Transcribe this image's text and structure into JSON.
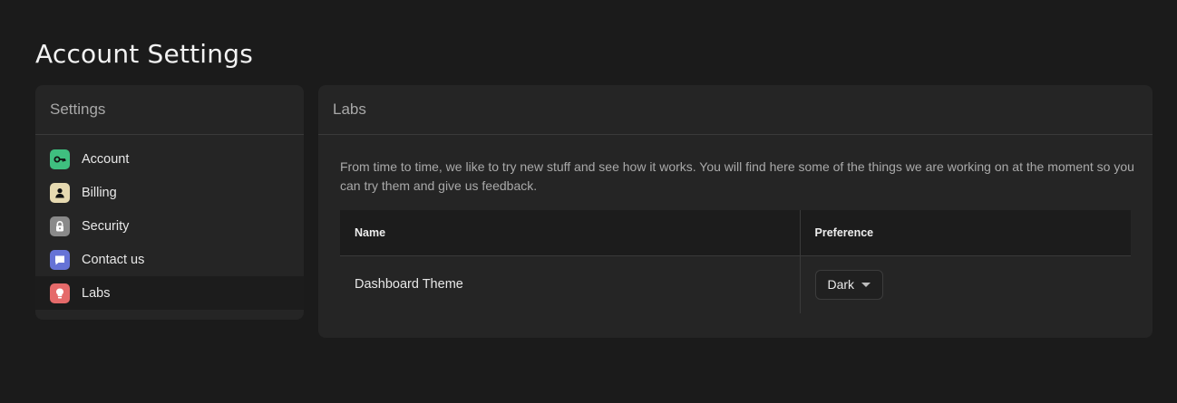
{
  "page": {
    "title": "Account Settings"
  },
  "sidebar": {
    "title": "Settings",
    "items": [
      {
        "label": "Account",
        "icon": "key-icon",
        "color": "#3fbf7f"
      },
      {
        "label": "Billing",
        "icon": "user-icon",
        "color": "#e6d9b0"
      },
      {
        "label": "Security",
        "icon": "lock-icon",
        "color": "#8a8a8a"
      },
      {
        "label": "Contact us",
        "icon": "chat-icon",
        "color": "#6673d6"
      },
      {
        "label": "Labs",
        "icon": "lightbulb-icon",
        "color": "#e56a6a"
      }
    ],
    "active": "Labs"
  },
  "panel": {
    "title": "Labs",
    "description": "From time to time, we like to try new stuff and see how it works. You will find here some of the things we are working on at the moment so you can try them and give us feedback.",
    "table": {
      "headers": [
        "Name",
        "Preference"
      ],
      "rows": [
        {
          "name": "Dashboard Theme",
          "preference": "Dark"
        }
      ]
    }
  }
}
